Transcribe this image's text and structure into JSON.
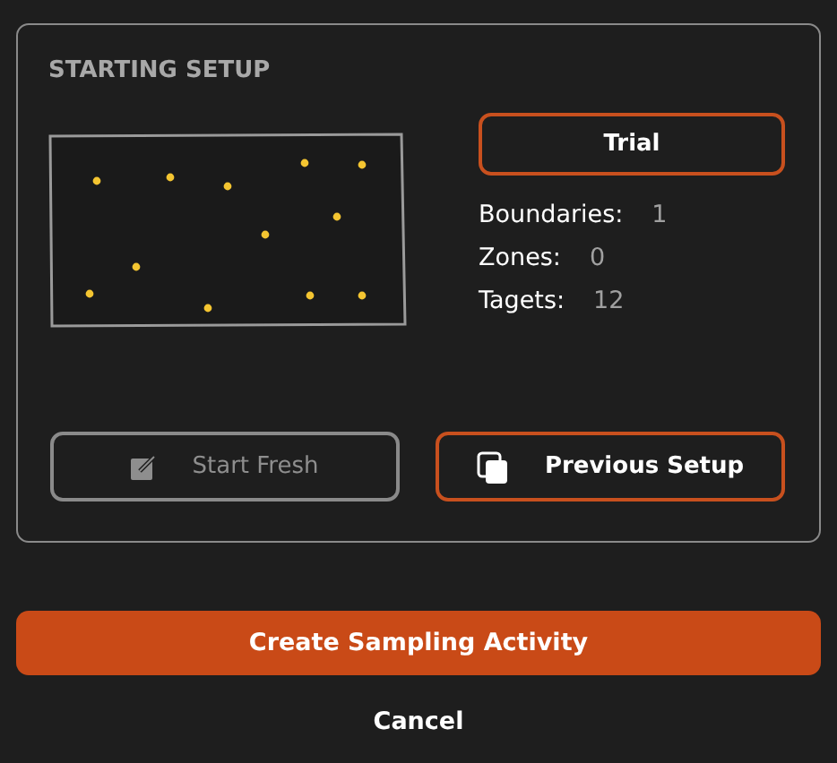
{
  "panel": {
    "title": "STARTING SETUP",
    "mode_button": "Trial",
    "stats": [
      {
        "label": "Boundaries:",
        "value": "1"
      },
      {
        "label": "Zones:",
        "value": "0"
      },
      {
        "label": "Tagets:",
        "value": "12"
      }
    ],
    "setup_buttons": [
      {
        "label": "Start Fresh",
        "disabled": true
      },
      {
        "label": "Previous Setup",
        "disabled": false
      }
    ]
  },
  "primary_button": "Create Sampling Activity",
  "cancel_link": "Cancel"
}
